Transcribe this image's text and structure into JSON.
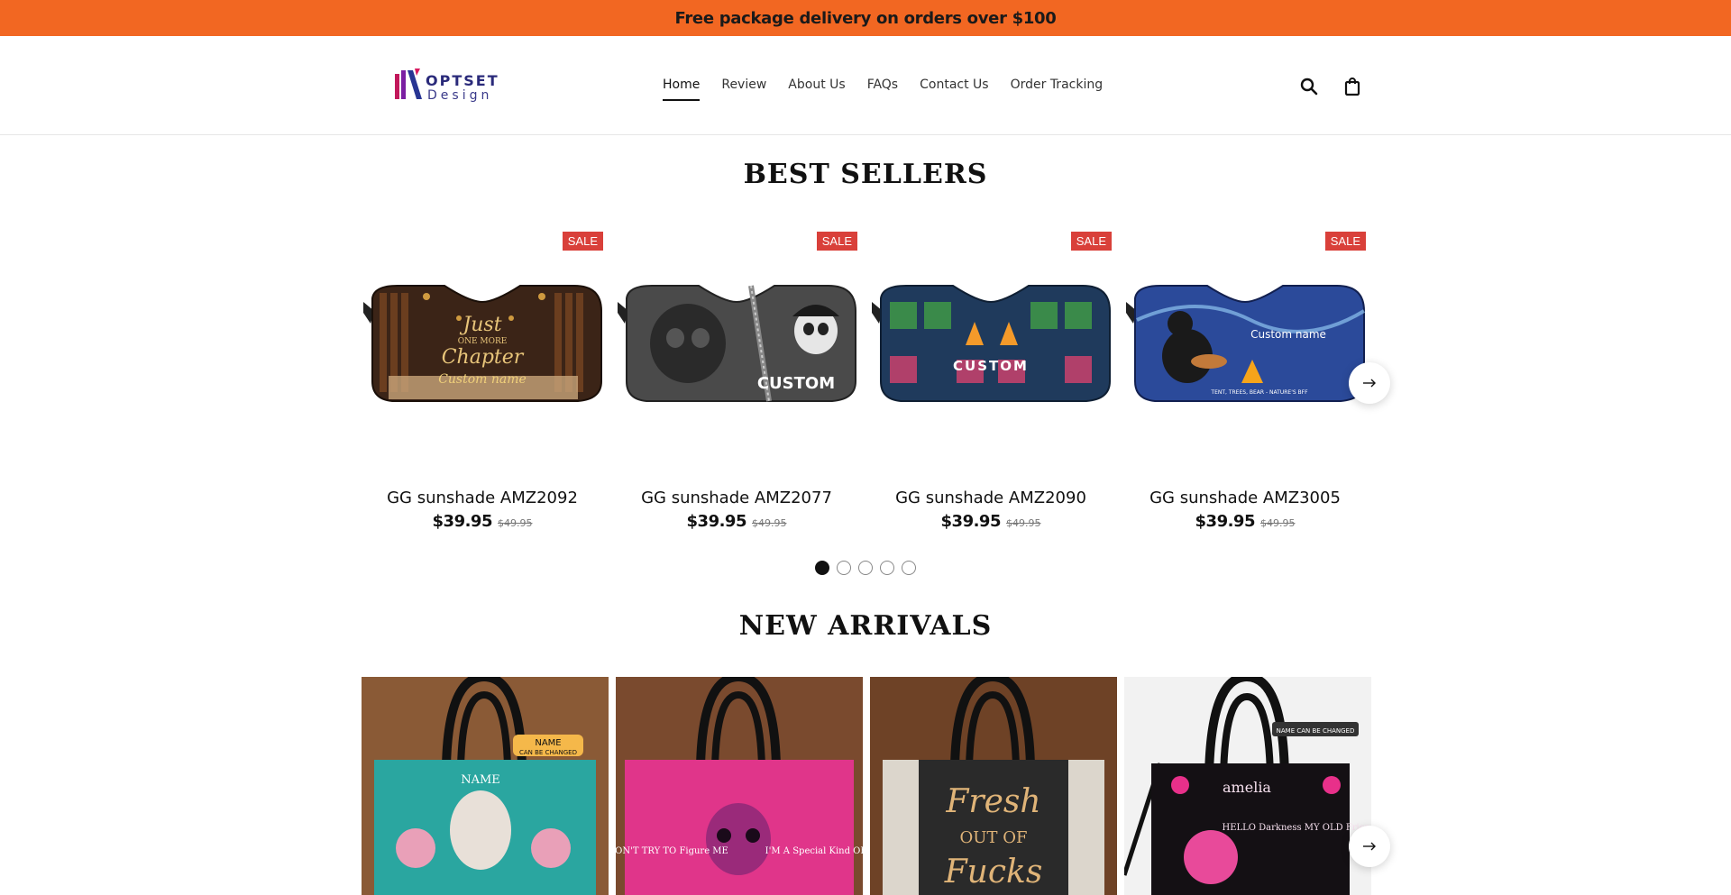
{
  "announcement": "Free package delivery on orders over $100",
  "logo": {
    "line1": "OPTSET",
    "line2": "Design"
  },
  "nav": {
    "items": [
      {
        "label": "Home",
        "active": true
      },
      {
        "label": "Review",
        "active": false
      },
      {
        "label": "About Us",
        "active": false
      },
      {
        "label": "FAQs",
        "active": false
      },
      {
        "label": "Contact Us",
        "active": false
      },
      {
        "label": "Order Tracking",
        "active": false
      }
    ]
  },
  "header_icons": [
    "search-icon",
    "shopping-bag-icon"
  ],
  "best_sellers": {
    "title": "BEST SELLERS",
    "products": [
      {
        "name": "GG sunshade AMZ2092",
        "price": "$39.95",
        "compare_price": "$49.95",
        "badge": "SALE",
        "image_text": [
          "Just",
          "ONE MORE",
          "Chapter",
          "Custom name"
        ]
      },
      {
        "name": "GG sunshade AMZ2077",
        "price": "$39.95",
        "compare_price": "$49.95",
        "badge": "SALE",
        "image_text": [
          "CUSTOM"
        ]
      },
      {
        "name": "GG sunshade AMZ2090",
        "price": "$39.95",
        "compare_price": "$49.95",
        "badge": "SALE",
        "image_text": [
          "CUSTOM"
        ]
      },
      {
        "name": "GG sunshade AMZ3005",
        "price": "$39.95",
        "compare_price": "$49.95",
        "badge": "SALE",
        "image_text": [
          "Custom name",
          "TENT, TREES, BEAR - NATURE'S BFF"
        ]
      }
    ],
    "pagination": {
      "total": 5,
      "current": 1
    }
  },
  "new_arrivals": {
    "title": "NEW ARRIVALS",
    "products": [
      {
        "image_text": [
          "NAME",
          "CAN BE CHANGED",
          "NAME"
        ]
      },
      {
        "image_text": [
          "DON'T TRY TO Figure ME",
          "I'M A Special Kind OF"
        ]
      },
      {
        "image_text": [
          "Fresh",
          "OUT OF",
          "Fucks"
        ]
      },
      {
        "image_text": [
          "NAME CAN BE CHANGED",
          "amelia",
          "HELLO Darkness MY OLD Friend"
        ]
      }
    ]
  },
  "colors": {
    "announcement_bg": "#f26722",
    "sale_badge": "#d9403a",
    "text": "#111111"
  }
}
